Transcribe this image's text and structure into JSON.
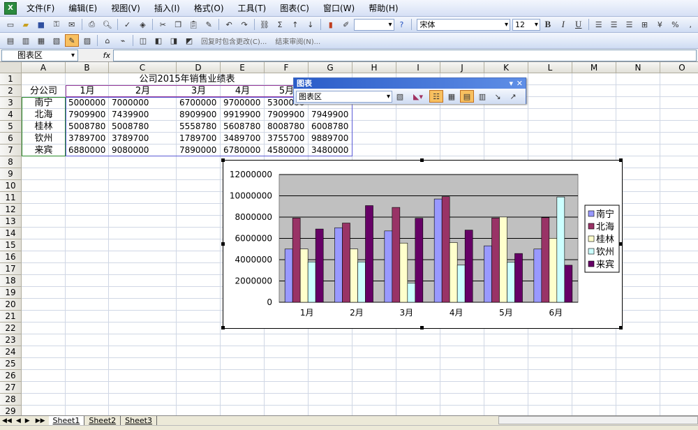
{
  "menu": [
    "文件(F)",
    "编辑(E)",
    "视图(V)",
    "插入(I)",
    "格式(O)",
    "工具(T)",
    "图表(C)",
    "窗口(W)",
    "帮助(H)"
  ],
  "font": {
    "name": "宋体",
    "size": "12"
  },
  "toolbar2": {
    "reply_label": "回复时包含更改(C)...",
    "end_review": "结束审阅(N)..."
  },
  "namebox": "图表区",
  "fx": "fx",
  "columns": [
    "A",
    "B",
    "C",
    "D",
    "E",
    "F",
    "G",
    "H",
    "I",
    "J",
    "K",
    "L",
    "M",
    "N",
    "O"
  ],
  "rows": [
    "1",
    "2",
    "3",
    "4",
    "5",
    "6",
    "7",
    "8",
    "9",
    "10",
    "11",
    "12",
    "13",
    "14",
    "15",
    "16",
    "17",
    "18",
    "19",
    "20",
    "21",
    "22",
    "23",
    "24",
    "25",
    "26",
    "27",
    "28",
    "29"
  ],
  "sheet": {
    "title": "公司2015年销售业绩表",
    "header": [
      "分公司",
      "1月",
      "2月",
      "3月",
      "4月",
      "5月"
    ],
    "data": [
      [
        "南宁",
        "5000000",
        "7000000",
        "6700000",
        "9700000",
        "5300000",
        ""
      ],
      [
        "北海",
        "7909900",
        "7439900",
        "8909900",
        "9919900",
        "7909900",
        "7949900"
      ],
      [
        "桂林",
        "5008780",
        "5008780",
        "5558780",
        "5608780",
        "8008780",
        "6008780"
      ],
      [
        "钦州",
        "3789700",
        "3789700",
        "1789700",
        "3489700",
        "3755700",
        "9889700"
      ],
      [
        "来宾",
        "6880000",
        "9080000",
        "7890000",
        "6780000",
        "4580000",
        "3480000"
      ]
    ]
  },
  "chart_toolbar": {
    "title": "图表",
    "select": "图表区"
  },
  "chart_data": {
    "type": "bar",
    "categories": [
      "1月",
      "2月",
      "3月",
      "4月",
      "5月",
      "6月"
    ],
    "series": [
      {
        "name": "南宁",
        "values": [
          5000000,
          7000000,
          6700000,
          9700000,
          5300000,
          5000000
        ],
        "color": "#9999ff"
      },
      {
        "name": "北海",
        "values": [
          7909900,
          7439900,
          8909900,
          9919900,
          7909900,
          7949900
        ],
        "color": "#993366"
      },
      {
        "name": "桂林",
        "values": [
          5008780,
          5008780,
          5558780,
          5608780,
          8008780,
          6008780
        ],
        "color": "#ffffcc"
      },
      {
        "name": "钦州",
        "values": [
          3789700,
          3789700,
          1789700,
          3489700,
          3755700,
          9889700
        ],
        "color": "#ccffff"
      },
      {
        "name": "来宾",
        "values": [
          6880000,
          9080000,
          7890000,
          6780000,
          4580000,
          3480000
        ],
        "color": "#660066"
      }
    ],
    "yticks": [
      "0",
      "2000000",
      "4000000",
      "6000000",
      "8000000",
      "10000000",
      "12000000"
    ],
    "ylim": [
      0,
      12000000
    ],
    "plot_bg": "#c0c0c0",
    "grid": true,
    "legend": "right"
  },
  "tabs": [
    "Sheet1",
    "Sheet2",
    "Sheet3"
  ]
}
